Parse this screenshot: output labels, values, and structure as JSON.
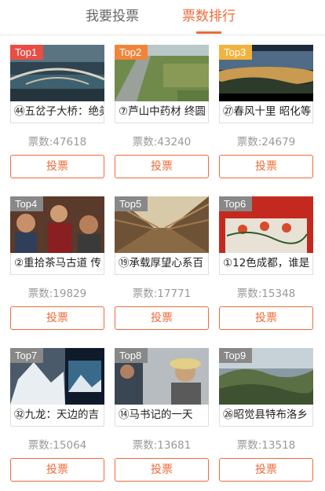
{
  "tabs": [
    {
      "label": "我要投票",
      "active": false
    },
    {
      "label": "票数排行",
      "active": true
    }
  ],
  "accent_color": "#ee6b3a",
  "rank_colors": {
    "top1": "#e94e45",
    "top2": "#f0853a",
    "top3": "#f2b33d",
    "other": "#888888"
  },
  "items": [
    {
      "rank": "Top1",
      "title": "㊹五岔子大桥：绝美",
      "votes": "票数:47618",
      "button": "投票"
    },
    {
      "rank": "Top2",
      "title": "⑦芦山中药材 终圆",
      "votes": "票数:43240",
      "button": "投票"
    },
    {
      "rank": "Top3",
      "title": "㉗春风十里 昭化等",
      "votes": "票数:24679",
      "button": "投票"
    },
    {
      "rank": "Top4",
      "title": "②重拾茶马古道 传",
      "votes": "票数:19829",
      "button": "投票"
    },
    {
      "rank": "Top5",
      "title": "⑲承载厚望心系百",
      "votes": "票数:17771",
      "button": "投票"
    },
    {
      "rank": "Top6",
      "title": "①12色成都，谁是",
      "votes": "票数:15348",
      "button": "投票"
    },
    {
      "rank": "Top7",
      "title": "㉜九龙：天边的吉",
      "votes": "票数:15064",
      "button": "投票"
    },
    {
      "rank": "Top8",
      "title": "⑭马书记的一天",
      "votes": "票数:13681",
      "button": "投票"
    },
    {
      "rank": "Top9",
      "title": "㉖昭觉县特布洛乡",
      "votes": "票数:13518",
      "button": "投票"
    }
  ]
}
